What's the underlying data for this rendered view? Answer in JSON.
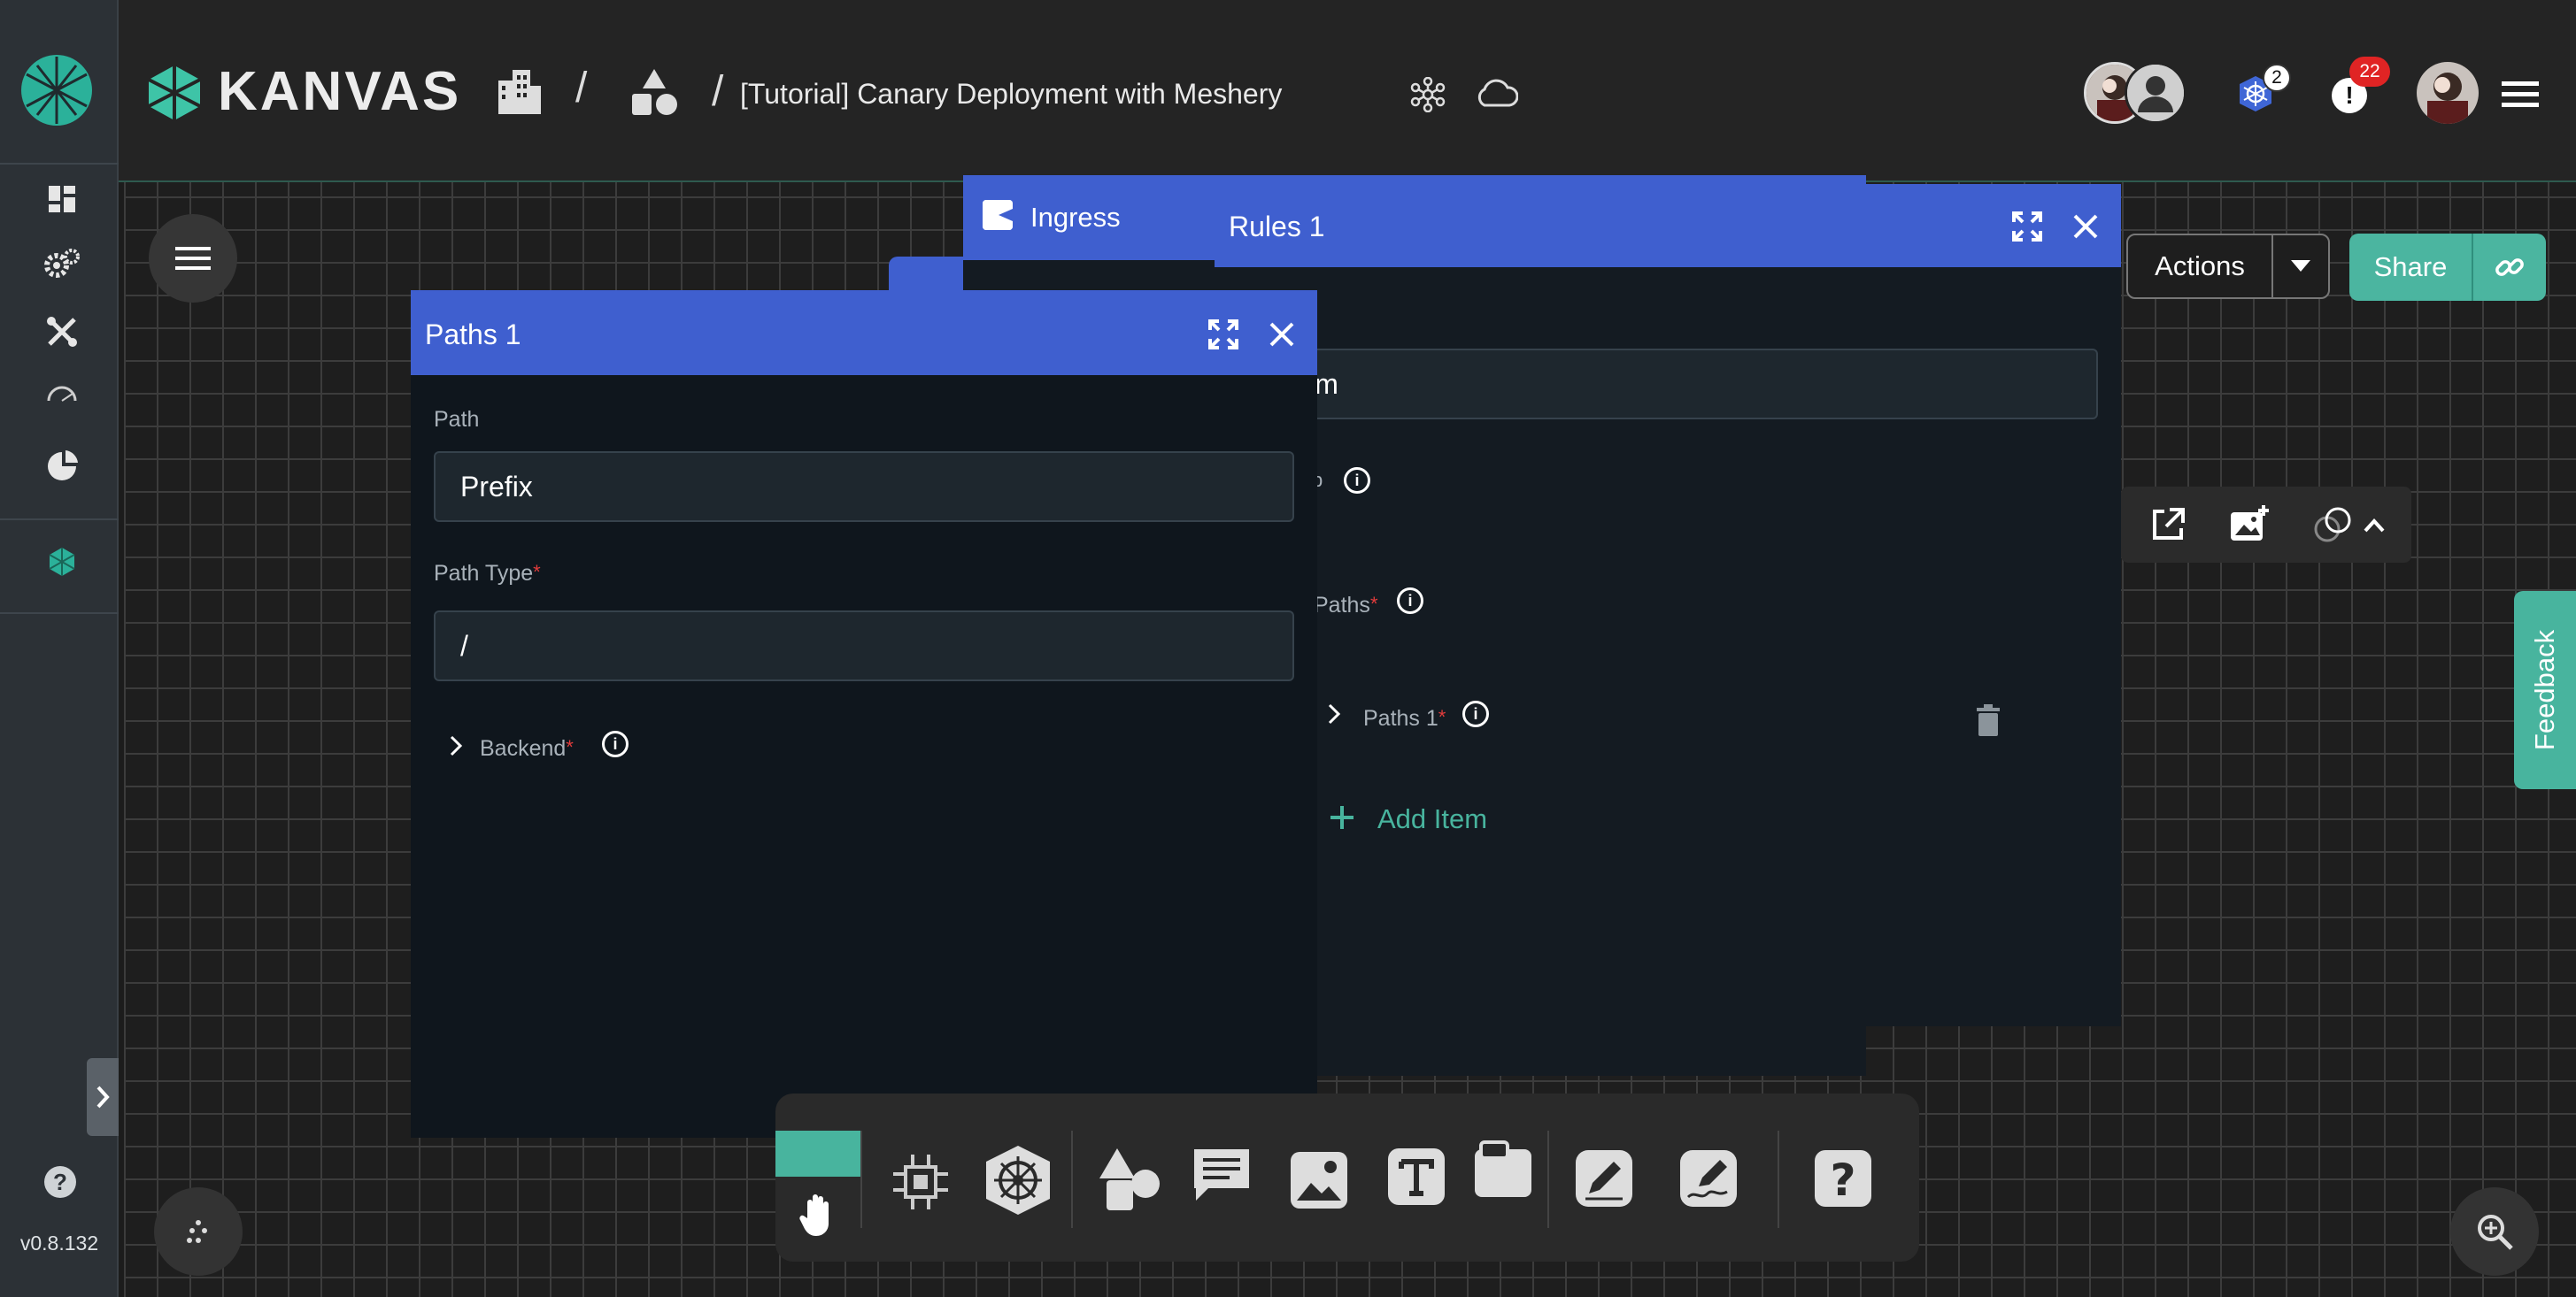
{
  "app": {
    "name": "KANVAS",
    "version": "v0.8.132"
  },
  "breadcrumb": {
    "separator1": "/",
    "separator2": "/",
    "design_title": "[Tutorial] Canary Deployment with Meshery"
  },
  "header": {
    "kubernetes_badge": "2",
    "notifications_badge": "22"
  },
  "toolbar": {
    "actions_label": "Actions",
    "share_label": "Share"
  },
  "feedback_label": "Feedback",
  "ingress_tab": {
    "label": "Ingress"
  },
  "rules_window": {
    "title": "Rules 1",
    "host_value": "nple.com",
    "partial_label": "p",
    "paths_label": "Paths",
    "paths_item_label": "Paths 1",
    "add_item_label": "Add Item"
  },
  "paths_window": {
    "title": "Paths 1",
    "path_label": "Path",
    "path_value": "Prefix",
    "path_type_label": "Path Type",
    "path_type_value": "/",
    "backend_label": "Backend",
    "required_mark": "*"
  },
  "icons": [
    "dashboard-icon",
    "settings-gears-icon",
    "tools-icon",
    "gauge-icon",
    "performance-icon",
    "meshery-icon",
    "help-icon",
    "building-icon",
    "shapes-icon",
    "cluster-icon",
    "cloud-icon",
    "kubernetes-icon",
    "alert-icon",
    "menu-icon",
    "hand-icon",
    "component-icon",
    "helm-icon",
    "shapes-icon",
    "comment-icon",
    "image-icon",
    "text-icon",
    "section-icon",
    "pen-icon",
    "freehand-icon",
    "question-icon",
    "zoom-in-icon"
  ]
}
